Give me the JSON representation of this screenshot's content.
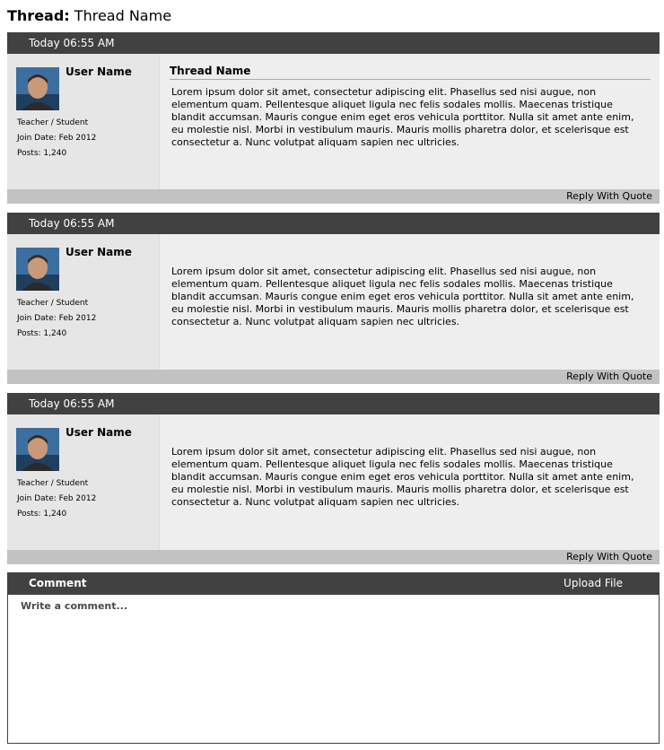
{
  "thread": {
    "label": "Thread:",
    "name": "Thread Name"
  },
  "posts": [
    {
      "timestamp": "Today 06:55 AM",
      "user": {
        "name": "User Name",
        "role": "Teacher / Student",
        "join_date": "Join Date: Feb 2012",
        "posts": "Posts: 1,240"
      },
      "title": "Thread Name",
      "body": "Lorem ipsum dolor sit amet, consectetur adipiscing elit. Phasellus sed nisi augue, non elementum quam. Pellentesque aliquet ligula nec felis sodales mollis. Maecenas tristique blandit accumsan. Mauris congue enim eget eros vehicula porttitor. Nulla sit amet ante enim, eu molestie nisl. Morbi in vestibulum mauris. Mauris mollis pharetra dolor, et scelerisque est consectetur a. Nunc volutpat aliquam sapien nec ultricies.",
      "reply_label": "Reply With Quote"
    },
    {
      "timestamp": "Today 06:55 AM",
      "user": {
        "name": "User Name",
        "role": "Teacher / Student",
        "join_date": "Join Date: Feb 2012",
        "posts": "Posts: 1,240"
      },
      "body": "Lorem ipsum dolor sit amet, consectetur adipiscing elit. Phasellus sed nisi augue, non elementum quam. Pellentesque aliquet ligula nec felis sodales mollis. Maecenas tristique blandit accumsan. Mauris congue enim eget eros vehicula porttitor. Nulla sit amet ante enim, eu molestie nisl. Morbi in vestibulum mauris. Mauris mollis pharetra dolor, et scelerisque est consectetur a. Nunc volutpat aliquam sapien nec ultricies.",
      "reply_label": "Reply With Quote"
    },
    {
      "timestamp": "Today 06:55 AM",
      "user": {
        "name": "User Name",
        "role": "Teacher / Student",
        "join_date": "Join Date: Feb 2012",
        "posts": "Posts: 1,240"
      },
      "body": "Lorem ipsum dolor sit amet, consectetur adipiscing elit. Phasellus sed nisi augue, non elementum quam. Pellentesque aliquet ligula nec felis sodales mollis. Maecenas tristique blandit accumsan. Mauris congue enim eget eros vehicula porttitor. Nulla sit amet ante enim, eu molestie nisl. Morbi in vestibulum mauris. Mauris mollis pharetra dolor, et scelerisque est consectetur a. Nunc volutpat aliquam sapien nec ultricies.",
      "reply_label": "Reply With Quote"
    }
  ],
  "comment": {
    "label": "Comment",
    "upload_label": "Upload File",
    "placeholder": "Write a comment..."
  },
  "colors": {
    "header_bg": "#414141",
    "user_panel_bg": "#e6e6e6",
    "content_bg": "#eeeeee",
    "footer_bg": "#c2c2c2"
  }
}
